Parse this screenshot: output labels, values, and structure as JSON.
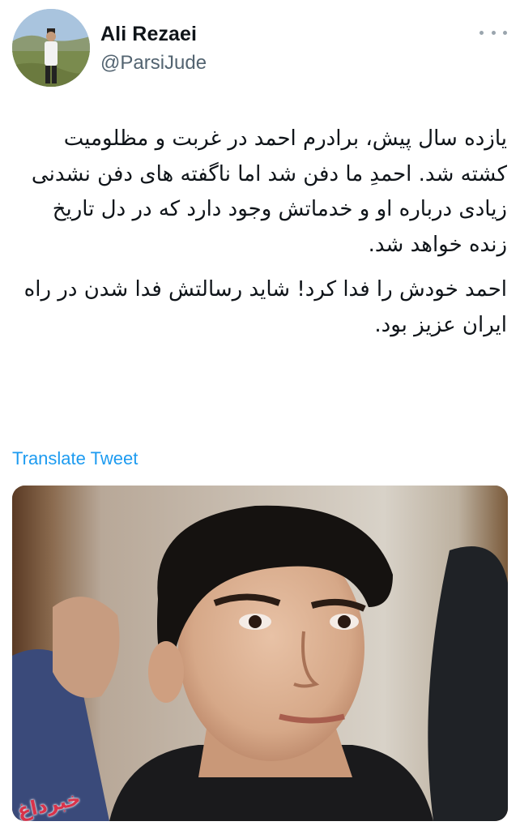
{
  "author": {
    "name": "Ali Rezaei",
    "handle": "@ParsiJude",
    "avatar_icon": "user-avatar-photo"
  },
  "tweet": {
    "paragraphs": [
      "یازده سال پیش، برادرم احمد در غربت و مظلومیت کشته شد. احمدِ ما دفن شد اما ناگفته های دفن نشدنی زیادی درباره او و خدماتش وجود دارد که در دل تاریخ زنده خواهد شد.",
      "احمد خودش را فدا کرد! شاید رسالتش فدا شدن در راه ایران عزیز بود."
    ],
    "translate_label": "Translate Tweet"
  },
  "media": {
    "watermark": "خبرداغ",
    "icon": "portrait-photo"
  },
  "colors": {
    "link": "#1d9bf0",
    "handle": "#536471",
    "text": "#0f1419"
  }
}
